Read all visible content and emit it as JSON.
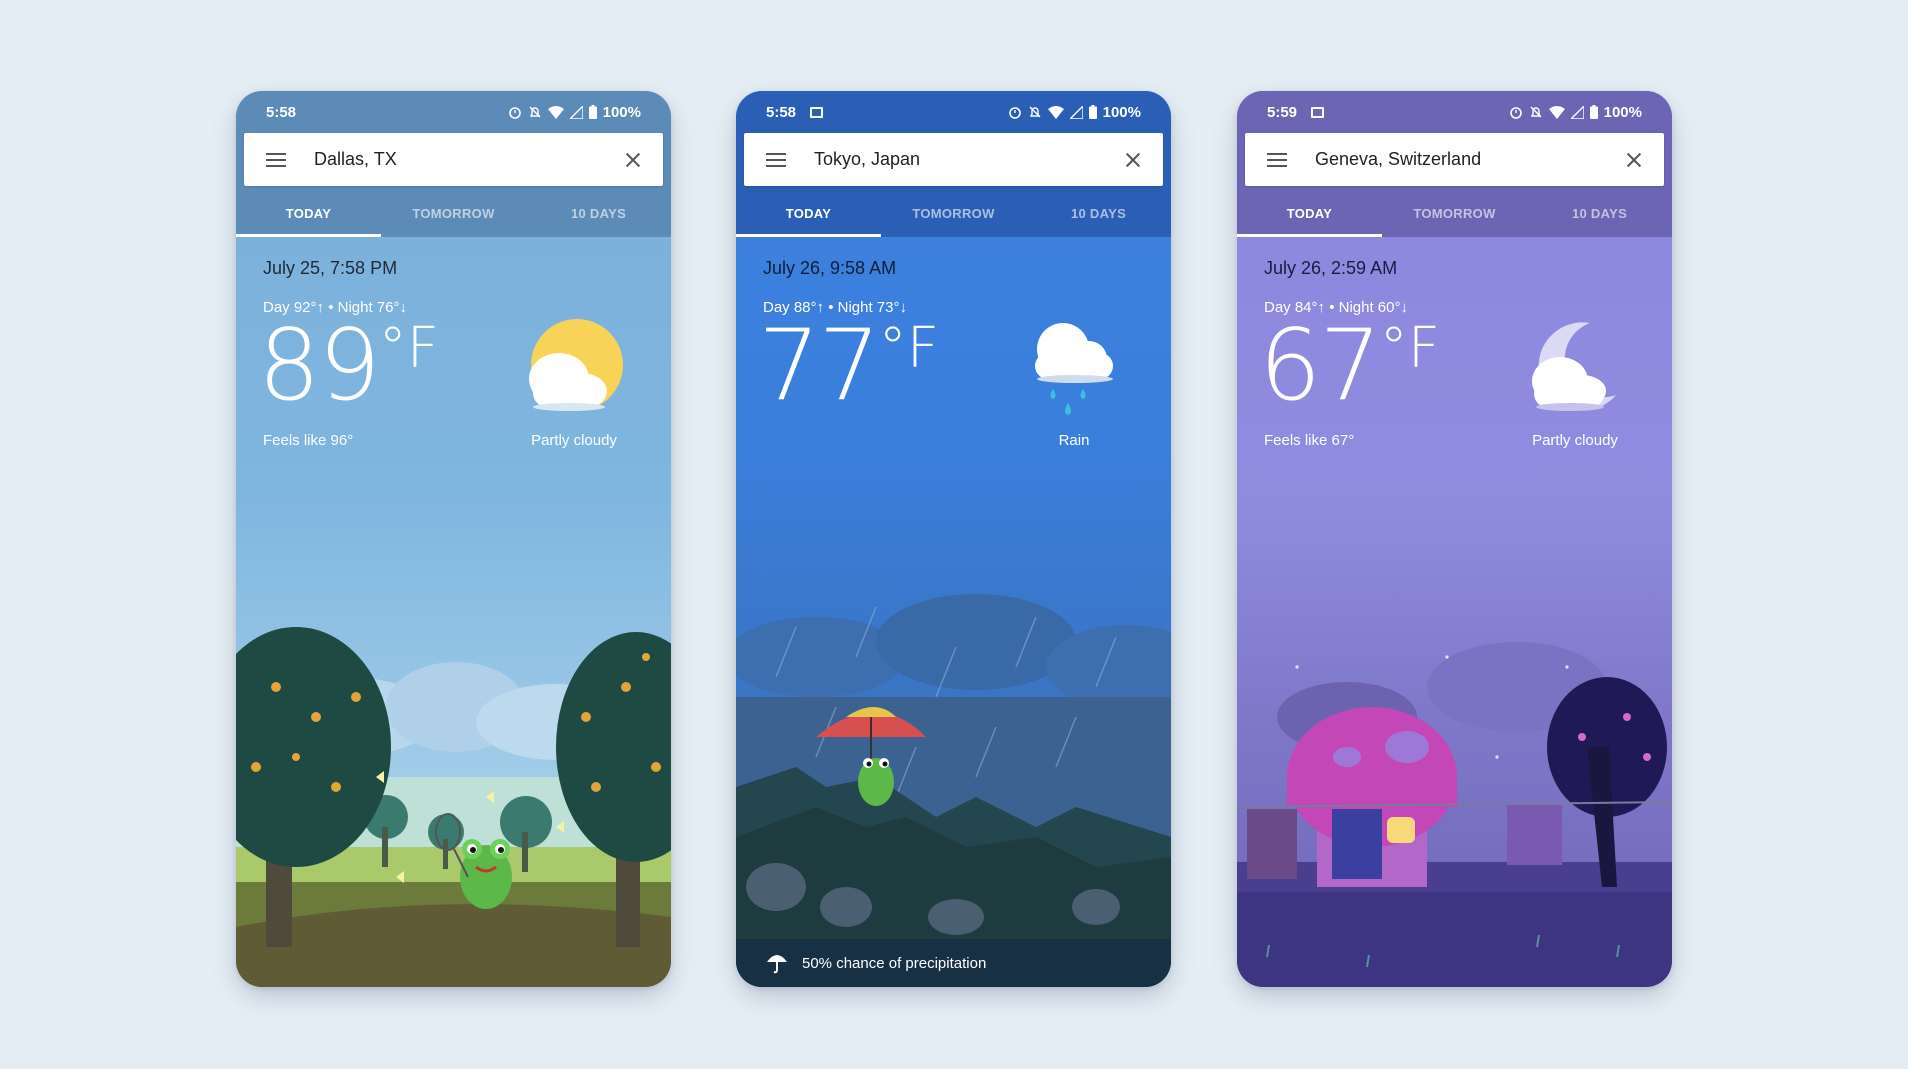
{
  "phones": [
    {
      "status": {
        "time": "5:58",
        "battery": "100%"
      },
      "search": {
        "value": "Dallas, TX"
      },
      "tabs": [
        "TODAY",
        "TOMORROW",
        "10 DAYS"
      ],
      "date": "July 25, 7:58 PM",
      "day_night": "Day 92°↑ • Night 76°↓",
      "temp": "89",
      "unit": "°F",
      "feels_like": "Feels like 96°",
      "condition": "Partly cloudy",
      "icon": "partly-cloudy-sun-icon"
    },
    {
      "status": {
        "time": "5:58",
        "battery": "100%"
      },
      "search": {
        "value": "Tokyo, Japan"
      },
      "tabs": [
        "TODAY",
        "TOMORROW",
        "10 DAYS"
      ],
      "date": "July 26, 9:58 AM",
      "day_night": "Day 88°↑ • Night 73°↓",
      "temp": "77",
      "unit": "°F",
      "condition": "Rain",
      "icon": "rain-cloud-icon",
      "precipitation": "50% chance of precipitation"
    },
    {
      "status": {
        "time": "5:59",
        "battery": "100%"
      },
      "search": {
        "value": "Geneva, Switzerland"
      },
      "tabs": [
        "TODAY",
        "TOMORROW",
        "10 DAYS"
      ],
      "date": "July 26, 2:59 AM",
      "day_night": "Day 84°↑ • Night 60°↓",
      "temp": "67",
      "unit": "°F",
      "feels_like": "Feels like 67°",
      "condition": "Partly cloudy",
      "icon": "partly-cloudy-moon-icon"
    }
  ],
  "colors": {
    "page_background": "#e6eef5",
    "dallas_bar": "#5d8bb7",
    "tokyo_bar": "#2b5fb6",
    "geneva_bar": "#6c65b3"
  }
}
